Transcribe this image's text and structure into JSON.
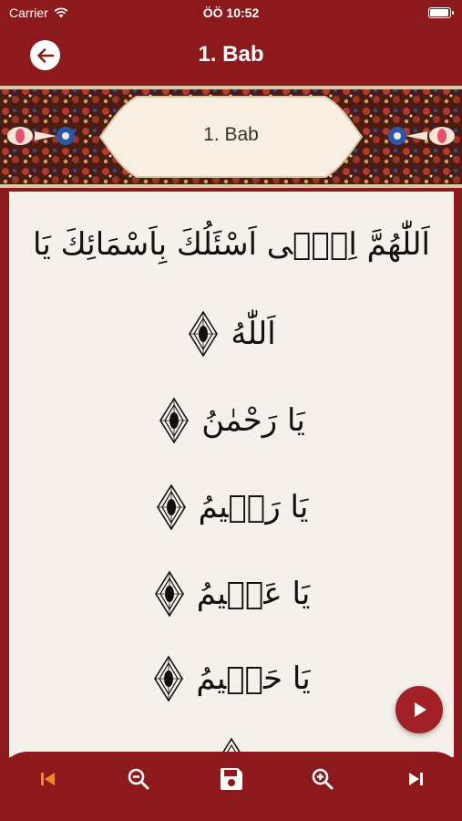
{
  "status_bar": {
    "carrier": "Carrier",
    "time": "ÖÖ 10:52",
    "battery_level": 1.0
  },
  "nav": {
    "title": "1. Bab",
    "back_icon": "arrow-left-icon"
  },
  "banner": {
    "title": "1. Bab"
  },
  "verses": [
    "اَللّٰهُمَّ اِنّٖى اَسْئَلُكَ بِاَسْمَائِكَ يَا",
    "اَللّٰهُ",
    "يَا رَحْمٰنُ",
    "يَا رَحٖيمُ",
    "يَا عَلٖيمُ",
    "يَا حَلٖيمُ"
  ],
  "toolbar": {
    "items": [
      {
        "icon": "skip-previous-icon",
        "color": "#f08a24"
      },
      {
        "icon": "zoom-out-icon",
        "color": "#ffffff"
      },
      {
        "icon": "save-icon",
        "color": "#ffffff"
      },
      {
        "icon": "zoom-in-icon",
        "color": "#ffffff"
      },
      {
        "icon": "skip-next-icon",
        "color": "#ffffff"
      }
    ]
  },
  "colors": {
    "primary": "#8c1a1d",
    "content_bg": "#f5f1ea",
    "accent": "#f08a24",
    "fab": "#a32126"
  }
}
